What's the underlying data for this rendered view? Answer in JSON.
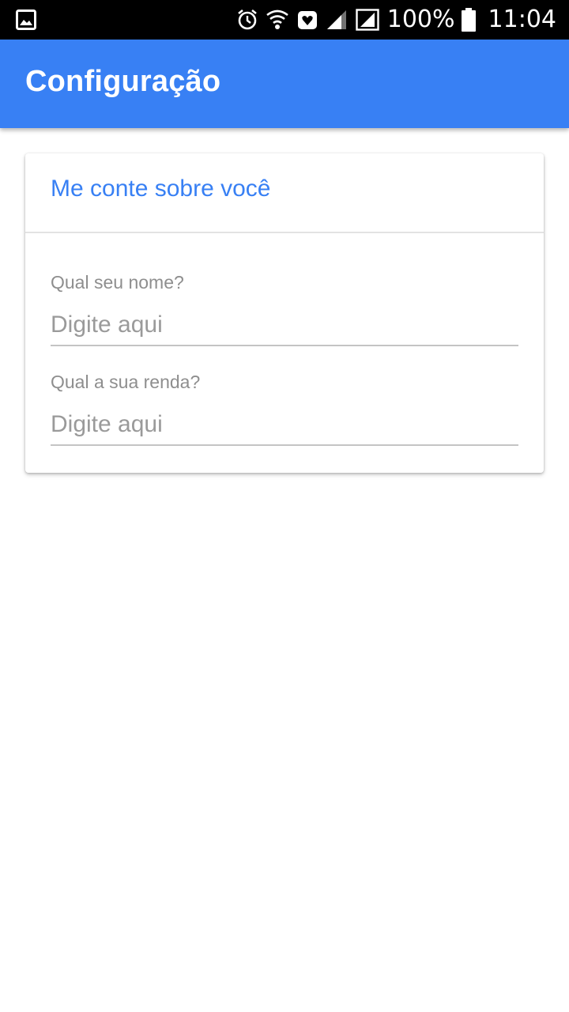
{
  "status_bar": {
    "icons": [
      "image-icon",
      "alarm-icon",
      "wifi-icon",
      "heart-icon",
      "signal-icon",
      "signal-sim-icon",
      "battery-icon"
    ],
    "battery_percent": "100%",
    "time": "11:04"
  },
  "app_bar": {
    "title": "Configuração",
    "color": "#3880f4"
  },
  "card": {
    "title": "Me conte sobre você",
    "fields": [
      {
        "label": "Qual seu nome?",
        "placeholder": "Digite aqui",
        "value": ""
      },
      {
        "label": "Qual a sua renda?",
        "placeholder": "Digite aqui",
        "value": ""
      }
    ]
  }
}
